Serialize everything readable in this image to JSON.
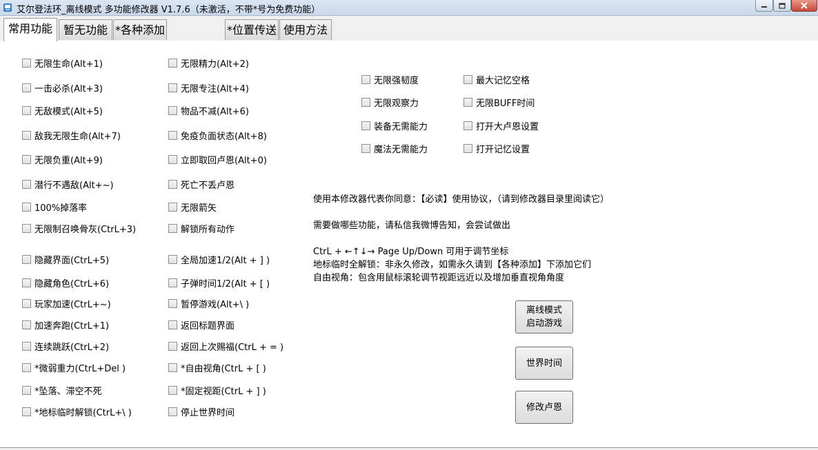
{
  "window": {
    "title": "艾尔登法环_离线模式 多功能修改器  V1.7.6（未激活，不带*号为免费功能）"
  },
  "tabs": [
    {
      "label": "常用功能",
      "active": true
    },
    {
      "label": "暂无功能",
      "active": false
    },
    {
      "label": "*各种添加",
      "active": false
    },
    {
      "label": "*位置传送",
      "active": false
    },
    {
      "label": "使用方法",
      "active": false
    }
  ],
  "col1": [
    "无限生命(Alt+1)",
    "一击必杀(Alt+3)",
    "无敌模式(Alt+5)",
    "敌我无限生命(Alt+7)",
    "无限负重(Alt+9)",
    "潜行不遇敌(Alt+~)",
    "100%掉落率",
    "无限制召唤骨灰(CtrL+3)",
    "隐藏界面(CtrL+5)",
    "隐藏角色(CtrL+6)",
    "玩家加速(CtrL+~)",
    "加速奔跑(CtrL+1)",
    "连续跳跃(CtrL+2)",
    "*微弱重力(CtrL+Del )",
    "*坠落、滞空不死",
    "*地标临时解锁(CtrL+\\ )"
  ],
  "col2": [
    "无限精力(Alt+2)",
    "无限专注(Alt+4)",
    "物品不减(Alt+6)",
    "免疫负面状态(Alt+8)",
    "立即取回卢恩(Alt+0)",
    "死亡不丢卢恩",
    "无限箭矢",
    "解锁所有动作",
    "全局加速1/2(Alt + ] )",
    "子弹时间1/2(Alt + [ )",
    "暂停游戏(Alt+\\ )",
    "返回标题界面",
    "返回上次赐福(CtrL + = )",
    "*自由视角(CtrL + [ )",
    "*固定视距(CtrL + ] )",
    "停止世界时间"
  ],
  "col3": [
    "无限强韧度",
    "无限观察力",
    "装备无需能力",
    "魔法无需能力"
  ],
  "col4": [
    "最大记忆空格",
    "无限BUFF时间",
    "打开大卢恩设置",
    "打开记忆设置"
  ],
  "info": {
    "agreement": "使用本修改器代表你同意：【必读】使用协议，（请到修改器目录里阅读它）",
    "request": "需要做哪些功能，请私信我微博告知，会尝试做出",
    "coords": "CtrL + ←↑↓→ Page Up/Down 可用于调节坐标",
    "landmark": "地标临时全解锁：非永久修改，如需永久请到【各种添加】下添加它们",
    "freeview": "自由视角：包含用鼠标滚轮调节视距远近以及增加垂直视角角度"
  },
  "buttons": {
    "offline_line1": "离线模式",
    "offline_line2": "启动游戏",
    "world_time": "世界时间",
    "modify_runes": "修改卢恩"
  },
  "colors": {
    "titlebar": "#c9d8eb",
    "panel": "#ffffff",
    "background": "#f0f0f0"
  }
}
